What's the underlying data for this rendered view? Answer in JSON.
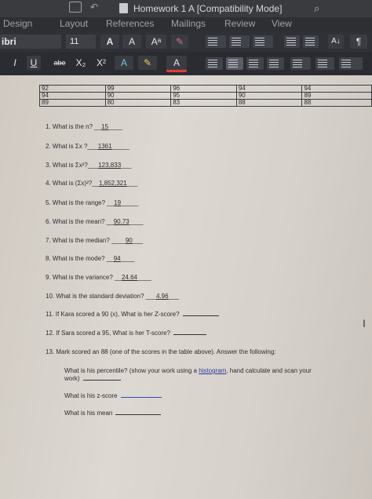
{
  "window": {
    "title": "Homework 1 A [Compatibility Mode]"
  },
  "tabs": [
    "Design",
    "Layout",
    "References",
    "Mailings",
    "Review",
    "View"
  ],
  "toolbar": {
    "font_name": "ibri",
    "font_size": "11",
    "grow": "A",
    "shrink": "A",
    "italic": "I",
    "underline": "U",
    "strike": "abe",
    "sub": "X₂",
    "sup": "X²"
  },
  "table": [
    [
      "92",
      "99",
      "96",
      "94",
      "94"
    ],
    [
      "94",
      "90",
      "95",
      "90",
      "89"
    ],
    [
      "89",
      "80",
      "83",
      "88",
      "88"
    ]
  ],
  "questions": [
    {
      "label": "1.  What is the n?",
      "answer": "15"
    },
    {
      "label": "2.  What is Σx ?",
      "answer": "1361"
    },
    {
      "label": "3.  What is Σx²?",
      "answer": "123,833"
    },
    {
      "label": "4.  What is (Σx)²?",
      "answer": "1,852,321"
    },
    {
      "label": "5.  What is the range?",
      "answer": "19"
    },
    {
      "label": "6.  What is the mean?",
      "answer": "90.73"
    },
    {
      "label": "7.  What is the median?",
      "answer": "90"
    },
    {
      "label": "8.  What is the mode?",
      "answer": "94"
    },
    {
      "label": "9.  What is the variance?",
      "answer": "24.64"
    },
    {
      "label": "10.  What is the standard deviation?",
      "answer": "4.96"
    },
    {
      "label": "11.  If Kara scored a 90 (x), What is her Z-score?",
      "answer": ""
    },
    {
      "label": "12.  If Sara scored a 95, What is her T-score?",
      "answer": ""
    },
    {
      "label": "13.  Mark scored an 88 (one of the scores in the table above).  Answer the following:",
      "answer": ""
    }
  ],
  "sub_questions": {
    "percentile_a": "What is his percentile? (show your work using a",
    "histogram": "histogram",
    "percentile_b": ", hand calculate and scan your",
    "percentile_c": "work)",
    "zscore": "What is his z-score",
    "mean": "What is his mean"
  }
}
